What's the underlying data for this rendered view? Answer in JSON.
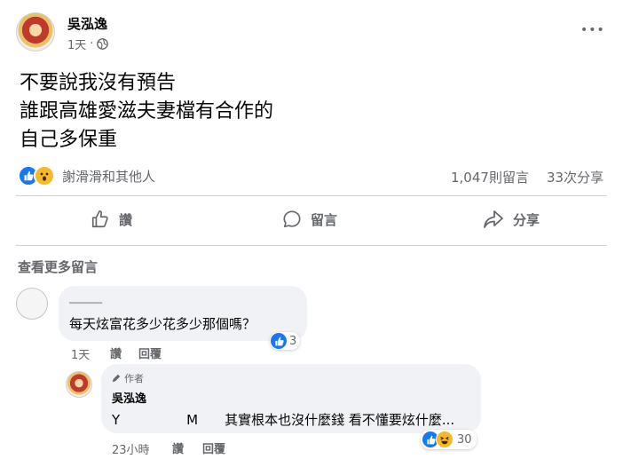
{
  "post": {
    "author": "吳泓逸",
    "time": "1天",
    "more_label": "•••",
    "text": "不要說我沒有預告\n誰跟高雄愛滋夫妻檔有合作的\n自己多保重",
    "reactions_text": "謝滑滑和其他人",
    "comments_count": "1,047則留言",
    "shares_count": "33次分享"
  },
  "actions": {
    "like": "讚",
    "comment": "留言",
    "share": "分享"
  },
  "comments_section": {
    "view_more": "查看更多留言"
  },
  "comment1": {
    "author": "▁▁▁▁",
    "text": "每天炫富花多少花多少那個嗎？",
    "time": "1天",
    "like_label": "讚",
    "reply_label": "回覆",
    "reaction_count": "3"
  },
  "reply1": {
    "badge": "作者",
    "author": "吳泓逸",
    "text": "Y　　　　　M　　其實根本也沒什麼錢 看不懂要炫什麼...",
    "time": "23小時",
    "like_label": "讚",
    "reply_label": "回覆",
    "reaction_count": "30"
  },
  "colors": {
    "like_blue": "#1877f2",
    "wow_yellow": "#f7b928",
    "text_secondary": "#65676b",
    "bubble_bg": "#f0f2f5"
  }
}
